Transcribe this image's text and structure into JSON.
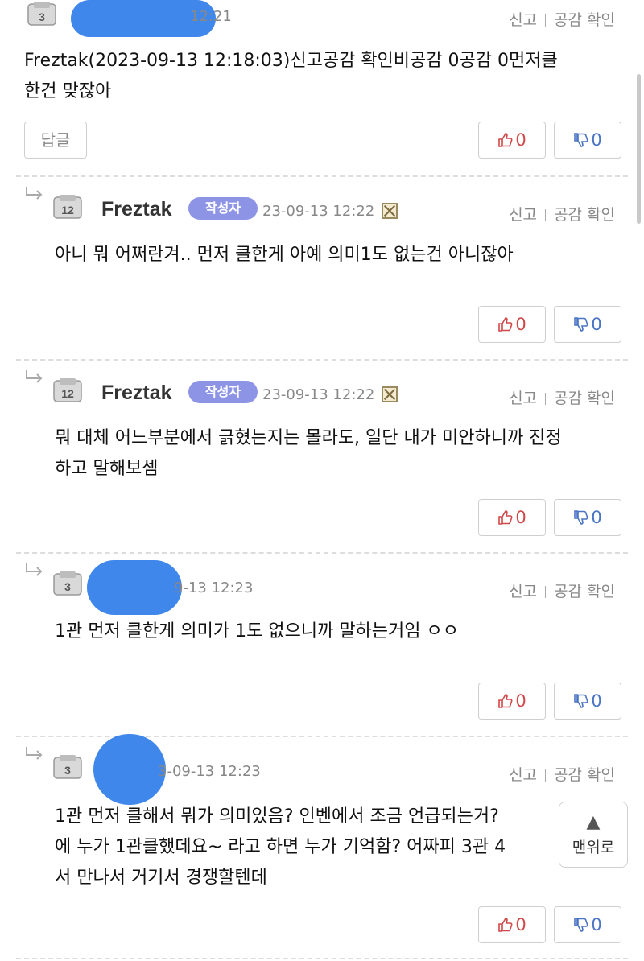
{
  "actions": {
    "report": "신고",
    "empathy_check": "공감 확인"
  },
  "comments": [
    {
      "level": "3",
      "nickname": "",
      "time": "12:21",
      "body_lines": [
        "Freztak(2023-09-13 12:18:03)신고공감 확인비공감 0공감 0먼저클",
        "한건 맞잖아"
      ],
      "reply_label": "답글",
      "likes": "0",
      "dislikes": "0"
    },
    {
      "level": "12",
      "nickname": "Freztak",
      "badge": "작성자",
      "time": "23-09-13 12:22",
      "body_lines": [
        "아니 뭐 어쩌란겨.. 먼저 클한게 아예 의미1도 없는건 아니잖아"
      ],
      "likes": "0",
      "dislikes": "0"
    },
    {
      "level": "12",
      "nickname": "Freztak",
      "badge": "작성자",
      "time": "23-09-13 12:22",
      "body_lines": [
        "뭐 대체 어느부분에서 긁혔는지는 몰라도, 일단 내가 미안하니까 진정",
        "하고 말해보셈"
      ],
      "likes": "0",
      "dislikes": "0"
    },
    {
      "level": "3",
      "nickname": "",
      "time": "9-13 12:23",
      "body_lines": [
        "1관 먼저 클한게 의미가 1도 없으니까 말하는거임 ㅇㅇ"
      ],
      "likes": "0",
      "dislikes": "0"
    },
    {
      "level": "3",
      "nickname": "",
      "time": "3-09-13 12:23",
      "body_lines": [
        "1관 먼저 클해서 뭐가 의미있음? 인벤에서 조금 언급되는거?",
        "에 누가 1관클했데요~ 라고 하면 누가 기억함? 어짜피 3관 4",
        "서 만나서 거기서 경쟁할텐데"
      ],
      "likes": "0",
      "dislikes": "0"
    }
  ],
  "scroll_top": {
    "label": "맨위로"
  }
}
